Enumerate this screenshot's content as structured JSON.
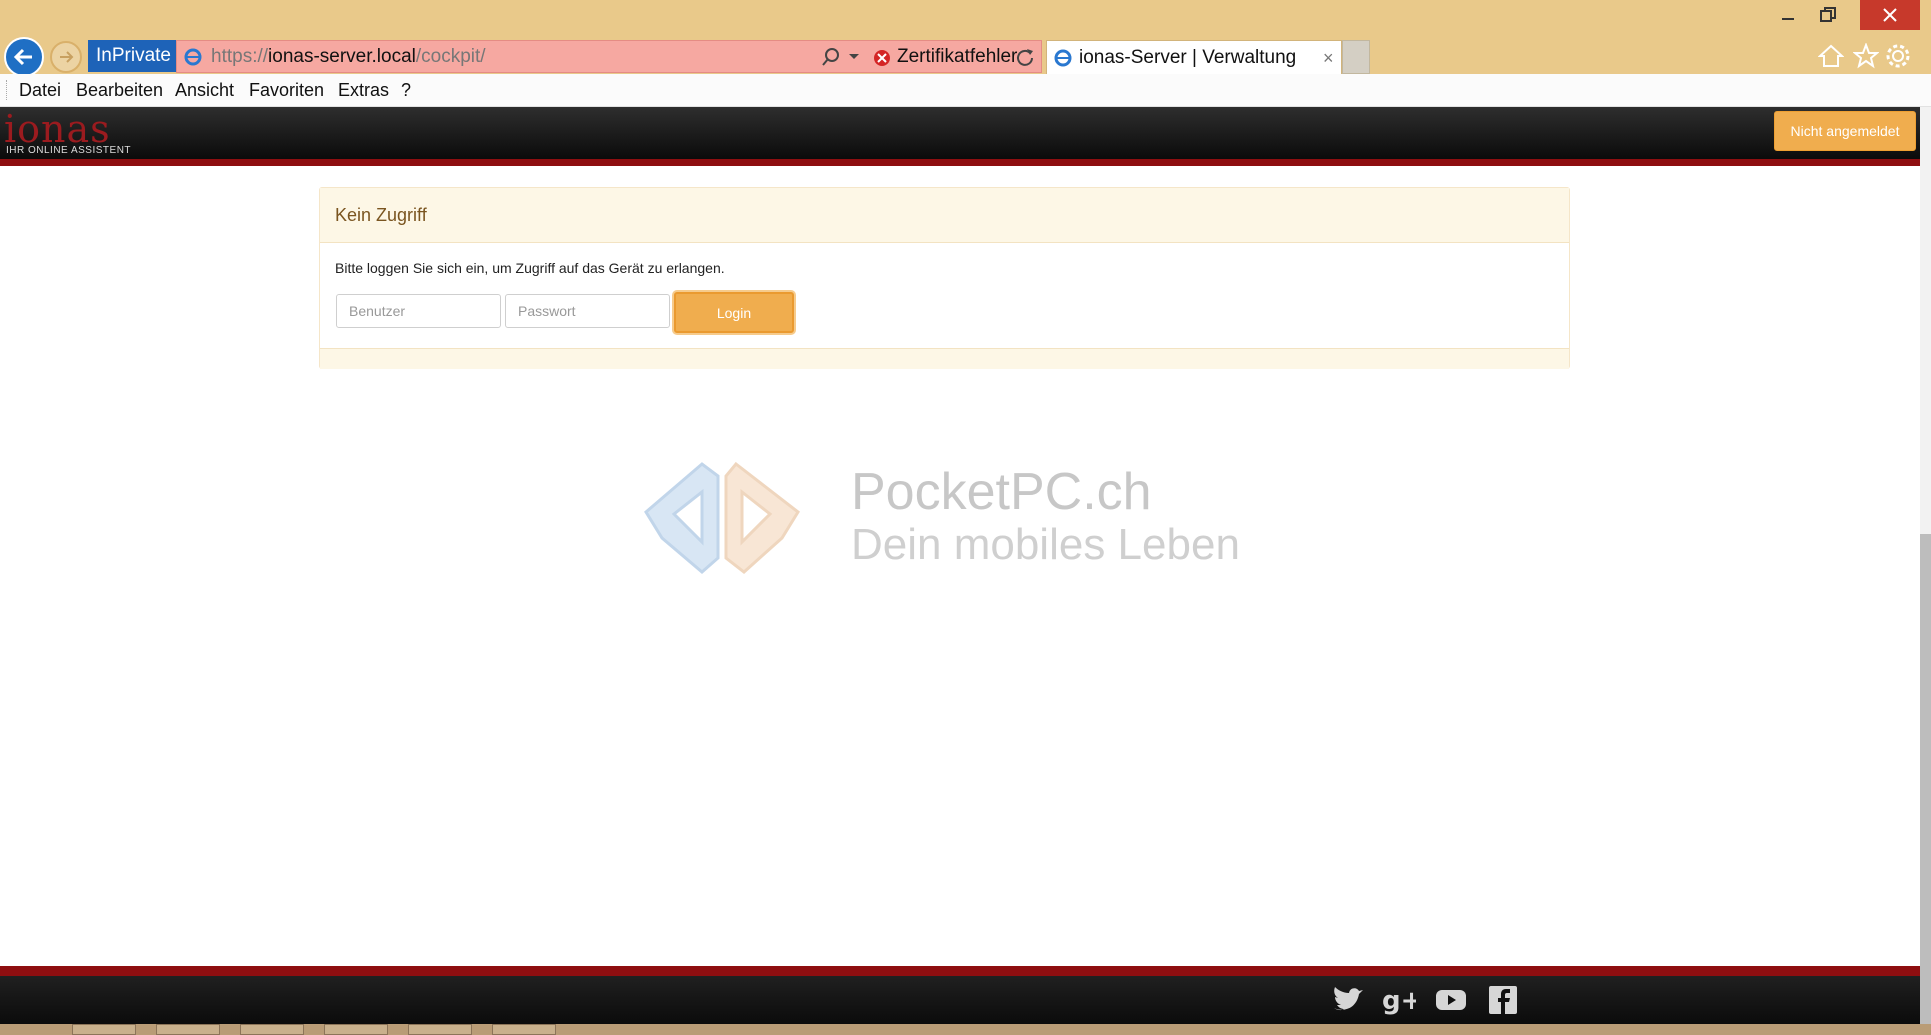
{
  "browser": {
    "window_controls": {
      "minimize": "–",
      "maximize": "❐",
      "close": "✕"
    },
    "inprivate_label": "InPrivate",
    "address": {
      "scheme": "https://",
      "host": "ionas-server.local",
      "path": "/cockpit/",
      "certificate_error": "Zertifikatfehler"
    },
    "tab": {
      "title": "ionas-Server | Verwaltung",
      "close": "×"
    },
    "menu": [
      "Datei",
      "Bearbeiten",
      "Ansicht",
      "Favoriten",
      "Extras",
      "?"
    ],
    "icons": [
      "back-arrow-icon",
      "forward-arrow-icon",
      "ie-icon",
      "search-icon",
      "chevron-down-icon",
      "error-icon",
      "refresh-icon",
      "home-icon",
      "star-icon",
      "gear-icon"
    ]
  },
  "site": {
    "logo": {
      "word": "ionas",
      "tagline": "IHR ONLINE ASSISTENT"
    },
    "login_status": "Nicht angemeldet",
    "panel": {
      "title": "Kein Zugriff",
      "message": "Bitte loggen Sie sich ein, um Zugriff auf das Gerät zu erlangen.",
      "user_placeholder": "Benutzer",
      "password_placeholder": "Passwort",
      "login_label": "Login"
    },
    "watermark": {
      "title": "PocketPC.ch",
      "subtitle": "Dein mobiles Leben"
    },
    "footer_social": [
      "twitter-icon",
      "google-plus-icon",
      "youtube-icon",
      "facebook-icon"
    ]
  },
  "colors": {
    "titlebar": "#e9c98a",
    "address_error": "#f6a8a1",
    "brand_red": "#8e0e10",
    "accent_orange": "#f0ad4e",
    "panel_heading": "#fdf7e6",
    "panel_title_text": "#7a5520"
  }
}
